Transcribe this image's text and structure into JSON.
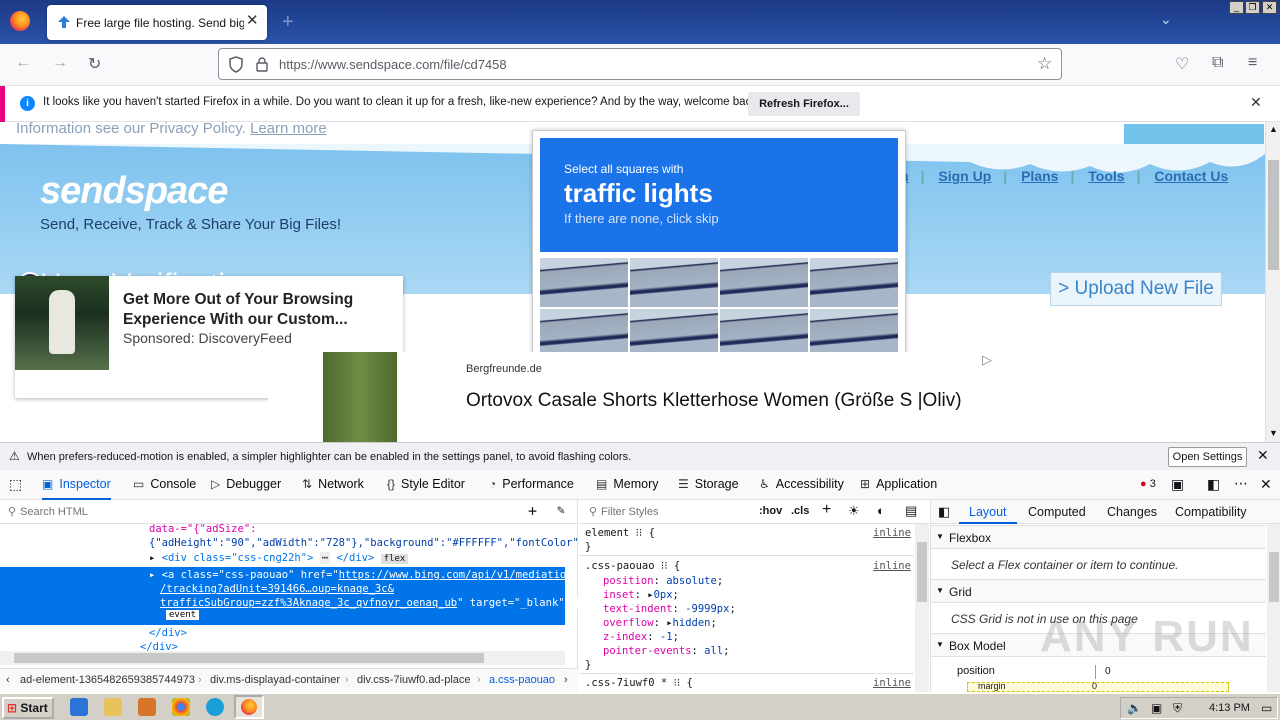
{
  "browser": {
    "tab_title": "Free large file hosting. Send big file",
    "url": "https://www.sendspace.com/file/cd7458",
    "notification_text": "It looks like you haven't started Firefox in a while. Do you want to clean it up for a fresh, like-new experience? And by the way, welcome back!",
    "refresh_button": "Refresh Firefox..."
  },
  "page": {
    "privacy_text": "Information see our Privacy Policy.",
    "learn_more": "Learn more",
    "logo": "sendspace",
    "tagline": "Send, Receive, Track & Share Your Big Files!",
    "nav": [
      "n",
      "Sign Up",
      "Plans",
      "Tools",
      "Contact Us"
    ],
    "heading": "User Verification",
    "upload_button": "> Upload New File"
  },
  "captcha": {
    "line1": "Select all squares with",
    "line2": "traffic lights",
    "line3": "If there are none, click skip"
  },
  "ad_card": {
    "title": "Get More Out of Your Browsing Experience With our Custom...",
    "sponsored": "Sponsored: DiscoveryFeed"
  },
  "product_ad": {
    "brand": "Bergfreunde.de",
    "title": "Ortovox Casale Shorts Kletterhose Women (Größe S |Oliv)"
  },
  "devtools": {
    "motion_notice": "When prefers-reduced-motion is enabled, a simpler highlighter can be enabled in the settings panel, to avoid flashing colors.",
    "open_settings": "Open Settings",
    "tabs": [
      "Inspector",
      "Console",
      "Debugger",
      "Network",
      "Style Editor",
      "Performance",
      "Memory",
      "Storage",
      "Accessibility",
      "Application"
    ],
    "error_count": "3",
    "search_html": "Search HTML",
    "filter_styles": "Filter Styles",
    "hov": ":hov",
    "cls": ".cls",
    "layout_tabs": [
      "Layout",
      "Computed",
      "Changes",
      "Compatibility"
    ],
    "html_lines": {
      "l1": "data-=\"{\"adSize\":",
      "l2": "{\"adHeight\":\"90\",\"adWidth\":\"728\"},\"background\":\"#FFFFFF\",\"fontColor\":",
      "l3": "<div class=\"css-cng22h\">",
      "l3b": "</div>",
      "flex_badge": "flex",
      "sel1a": "<a class=\"css-paouao\" href=\"",
      "sel1b": "https://www.bing.com/api/v1/mediation",
      "sel2": "/tracking?adUnit=391466…oup=knaqe_3c&",
      "sel3a": "trafficSubGroup=zzf%3Aknaqe_3c_qvfnoyr_oenaq_ub",
      "sel3b": "\" target=\"_blank\">",
      "event_badge": "event",
      "l_close1": "</div>",
      "l_close2": "</div>"
    },
    "breadcrumb": [
      "ad-element-13654826593857449​73",
      "div.ms-displayad-container",
      "div.css-7iuwf0.ad-place",
      "a.css-paouao"
    ],
    "rules": {
      "element": "element",
      "inline": "inline",
      "selector": ".css-paouao",
      "props": [
        {
          "name": "position",
          "value": "absolute"
        },
        {
          "name": "inset",
          "value": "0px"
        },
        {
          "name": "text-indent",
          "value": "-9999px"
        },
        {
          "name": "overflow",
          "value": "hidden"
        },
        {
          "name": "z-index",
          "value": "-1"
        },
        {
          "name": "pointer-events",
          "value": "all"
        }
      ],
      "next_selector": ".css-7iuwf0 *"
    },
    "layout": {
      "flexbox": "Flexbox",
      "flex_note": "Select a Flex container or item to continue.",
      "grid": "Grid",
      "grid_note": "CSS Grid is not in use on this page",
      "box_model": "Box Model",
      "position_label": "position",
      "position_value": "0",
      "margin_label": "margin",
      "margin_value": "0"
    }
  },
  "taskbar": {
    "start": "Start",
    "time": "4:13 PM"
  },
  "watermark": "ANY RUN"
}
